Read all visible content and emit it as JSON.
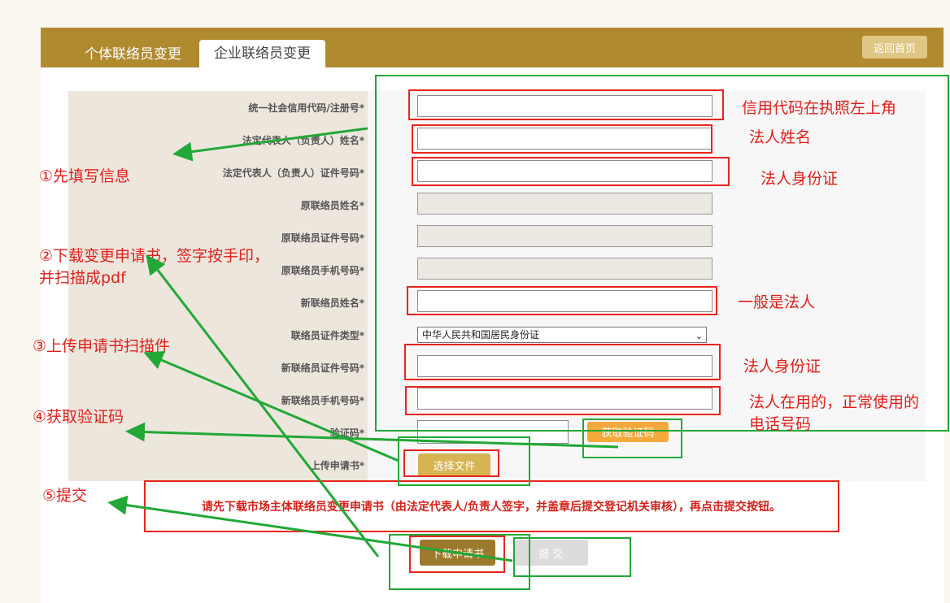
{
  "tabs": [
    "个体联络员变更",
    "企业联络员变更"
  ],
  "home_button": "返回首页",
  "form": {
    "labels": [
      "统一社会信用代码/注册号*",
      "法定代表人（负责人）姓名*",
      "法定代表人（负责人）证件号码*",
      "原联络员姓名*",
      "原联络员证件号码*",
      "原联络员手机号码*",
      "新联络员姓名*",
      "联络员证件类型*",
      "新联络员证件号码*",
      "新联络员手机号码*",
      "验证码*",
      "上传申请书*"
    ],
    "id_type_selected": "中华人民共和国居民身份证",
    "get_code_button": "获取验证码",
    "choose_file_button": "选择文件"
  },
  "notice": "请先下载市场主体联络员变更申请书（由法定代表人/负责人签字，并盖章后提交登记机关审核），再点击提交按钮。",
  "buttons": {
    "download": "下载申请书",
    "submit": "提 交"
  },
  "annotations": {
    "right": [
      "信用代码在执照左上角",
      "法人姓名",
      "法人身份证",
      "一般是法人",
      "法人身份证",
      "法人在用的，正常使用的",
      "电话号码"
    ],
    "steps": [
      "①先填写信息",
      "②下载变更申请书，签字按手印，",
      "并扫描成pdf",
      "③上传申请书扫描件",
      "④获取验证码",
      "⑤提交"
    ]
  },
  "colors": {
    "header": "#b08a2e",
    "annotation_red": "#e8251c",
    "annotation_green": "#21a836"
  }
}
